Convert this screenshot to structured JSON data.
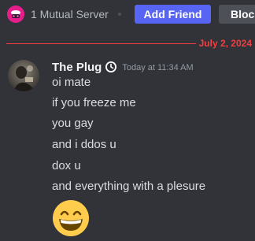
{
  "topbar": {
    "server_icon": "mutual-server-icon",
    "mutual_server_text": "1 Mutual Server",
    "add_friend_label": "Add Friend",
    "block_label": "Block"
  },
  "divider": {
    "date": "July 2, 2024"
  },
  "message": {
    "avatar": "user-avatar",
    "username": "The Plug",
    "badge_icon": "clock-icon",
    "timestamp": "Today at 11:34 AM",
    "lines": [
      "oi mate",
      "if you freeze me",
      "you gay",
      "and i ddos u",
      "dox u",
      "and everything with a plesure"
    ],
    "emoji": "grinning-smiling-eyes-emoji"
  },
  "colors": {
    "background": "#313338",
    "accent": "#5865f2",
    "divider_red": "#f23f42",
    "block_button": "#4e5058",
    "server_icon_pink": "#e61e8c"
  }
}
